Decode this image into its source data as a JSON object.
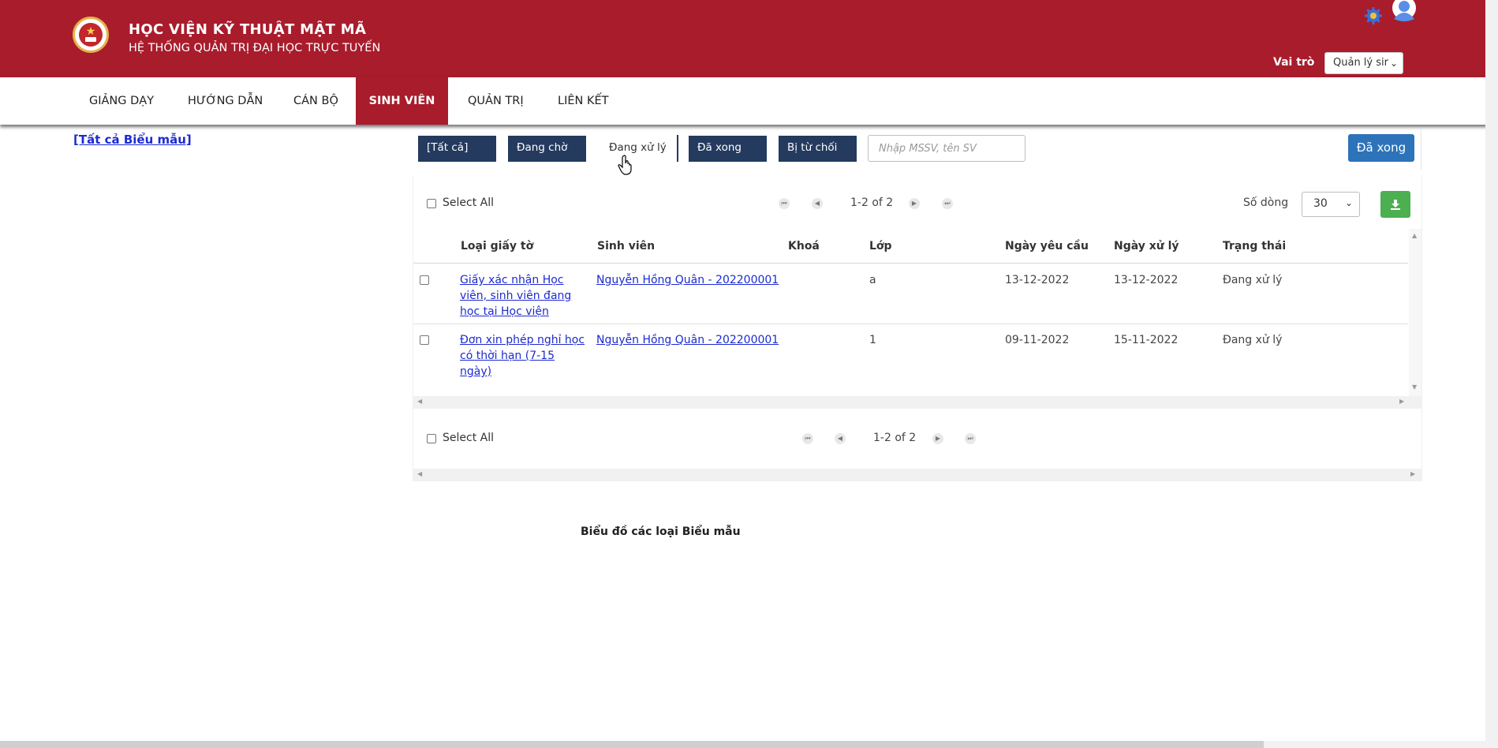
{
  "header": {
    "org_name": "HỌC VIỆN KỸ THUẬT MẬT MÃ",
    "system_name": "HỆ THỐNG QUẢN TRỊ ĐẠI HỌC TRỰC TUYẾN",
    "role_label": "Vai trò",
    "role_value": "Quản lý sir",
    "brand_color": "#a81c2c"
  },
  "nav": {
    "items": [
      "GIẢNG DẠY",
      "HƯỚNG DẪN",
      "CÁN BỘ",
      "SINH VIÊN",
      "QUẢN TRỊ",
      "LIÊN KẾT"
    ],
    "active": "SINH VIÊN"
  },
  "sidebar": {
    "all_forms_link": "[Tất cả Biểu mẫu]"
  },
  "filters": {
    "buttons": [
      "[Tất cả]",
      "Đang chờ",
      "Đang xử lý",
      "Đã xong",
      "Bị từ chối"
    ],
    "selected": "Đang xử lý",
    "search_placeholder": "Nhập MSSV, tên SV",
    "action_button": "Đã xong"
  },
  "grid": {
    "select_all_label": "Select All",
    "pagination_text": "1-2 of 2",
    "rows_label": "Số dòng",
    "rows_value": "30",
    "columns": [
      "Loại giấy tờ",
      "Sinh viên",
      "Khoá",
      "Lớp",
      "Ngày yêu cầu",
      "Ngày xử lý",
      "Trạng thái"
    ],
    "rows": [
      {
        "doc_type": "Giấy xác nhận Học viên, sinh viên đang học tại Học viện",
        "student": "Nguyễn Hồng Quân - 202200001",
        "course": "",
        "class": "a",
        "request_date": "13-12-2022",
        "process_date": "13-12-2022",
        "status": "Đang xử lý"
      },
      {
        "doc_type": "Đơn xin phép nghỉ học có thời hạn (7-15 ngày)",
        "student": "Nguyễn Hồng Quân - 202200001",
        "course": "",
        "class": "1",
        "request_date": "09-11-2022",
        "process_date": "15-11-2022",
        "status": "Đang xử lý"
      }
    ]
  },
  "chart": {
    "title": "Biểu đồ các loại Biểu mẫu"
  }
}
